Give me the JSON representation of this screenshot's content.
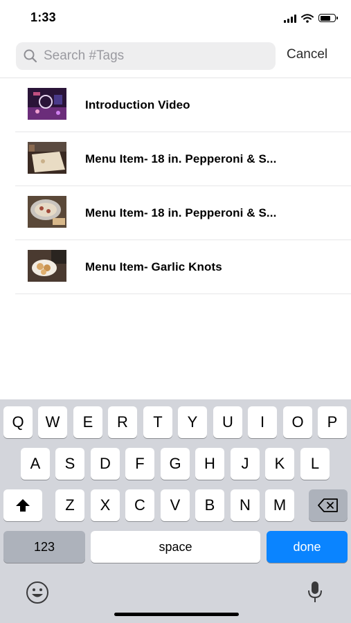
{
  "status_bar": {
    "time": "1:33",
    "battery_level": 0.7
  },
  "search": {
    "placeholder": "Search #Tags",
    "value": "",
    "cancel_label": "Cancel"
  },
  "results": [
    {
      "label": "Introduction Video",
      "thumbnail": "video-stage-thumbnail"
    },
    {
      "label": "Menu Item- 18 in. Pepperoni & S...",
      "thumbnail": "pizza-dough-thumbnail"
    },
    {
      "label": "Menu Item- 18 in. Pepperoni & S...",
      "thumbnail": "pizza-pan-thumbnail"
    },
    {
      "label": "Menu Item- Garlic Knots",
      "thumbnail": "garlic-knots-thumbnail"
    }
  ],
  "keyboard": {
    "row1": [
      "Q",
      "W",
      "E",
      "R",
      "T",
      "Y",
      "U",
      "I",
      "O",
      "P"
    ],
    "row2": [
      "A",
      "S",
      "D",
      "F",
      "G",
      "H",
      "J",
      "K",
      "L"
    ],
    "row3": [
      "Z",
      "X",
      "C",
      "V",
      "B",
      "N",
      "M"
    ],
    "numbers_label": "123",
    "space_label": "space",
    "done_label": "done",
    "icons": {
      "shift": "shift-icon",
      "backspace": "backspace-icon",
      "emoji": "emoji-icon",
      "mic": "microphone-icon"
    },
    "done_color": "#0a84ff"
  }
}
